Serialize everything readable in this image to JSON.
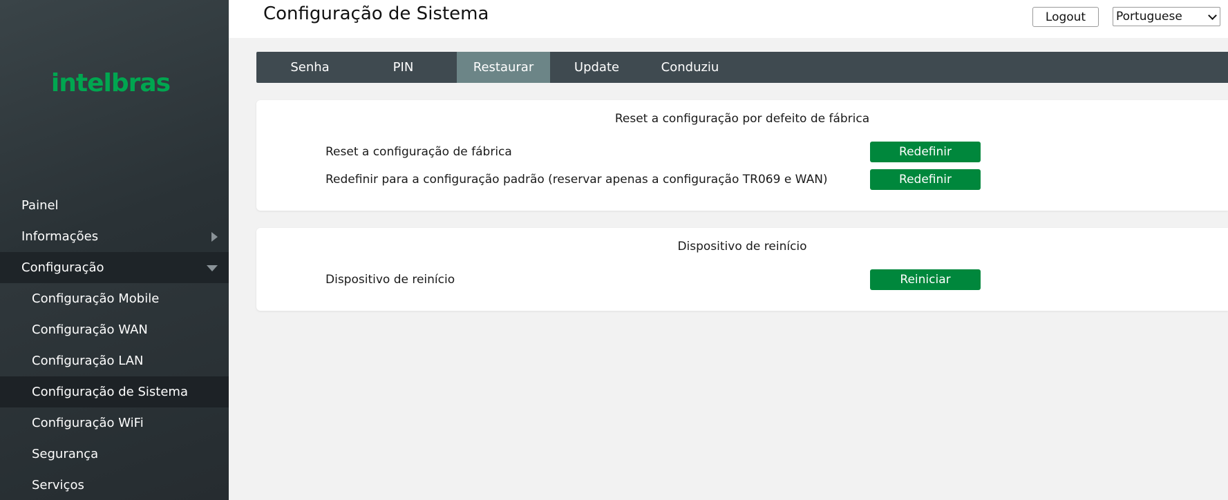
{
  "brand": {
    "logo_text": "intelbras",
    "accent_color": "#00a650",
    "button_color": "#00873c"
  },
  "header": {
    "title": "Configuração de Sistema",
    "logout_label": "Logout",
    "language_selected": "Portuguese"
  },
  "sidebar": {
    "items": [
      {
        "label": "Painel"
      },
      {
        "label": "Informações"
      },
      {
        "label": "Configuração"
      }
    ],
    "sub_items": [
      {
        "label": "Configuração Mobile"
      },
      {
        "label": "Configuração WAN"
      },
      {
        "label": "Configuração LAN"
      },
      {
        "label": "Configuração de Sistema"
      },
      {
        "label": "Configuração WiFi"
      },
      {
        "label": "Segurança"
      },
      {
        "label": "Serviços"
      }
    ]
  },
  "tabs": [
    {
      "label": "Senha"
    },
    {
      "label": "PIN"
    },
    {
      "label": "Restaurar"
    },
    {
      "label": "Update"
    },
    {
      "label": "Conduziu"
    }
  ],
  "reset_card": {
    "title": "Reset a configuração por defeito de fábrica",
    "rows": [
      {
        "label": "Reset a configuração de fábrica",
        "button": "Redefinir"
      },
      {
        "label": "Redefinir para a configuração padrão (reservar apenas a configuração TR069 e WAN)",
        "button": "Redefinir"
      }
    ]
  },
  "reboot_card": {
    "title": "Dispositivo de reinício",
    "rows": [
      {
        "label": "Dispositivo de reinício",
        "button": "Reiniciar"
      }
    ]
  }
}
